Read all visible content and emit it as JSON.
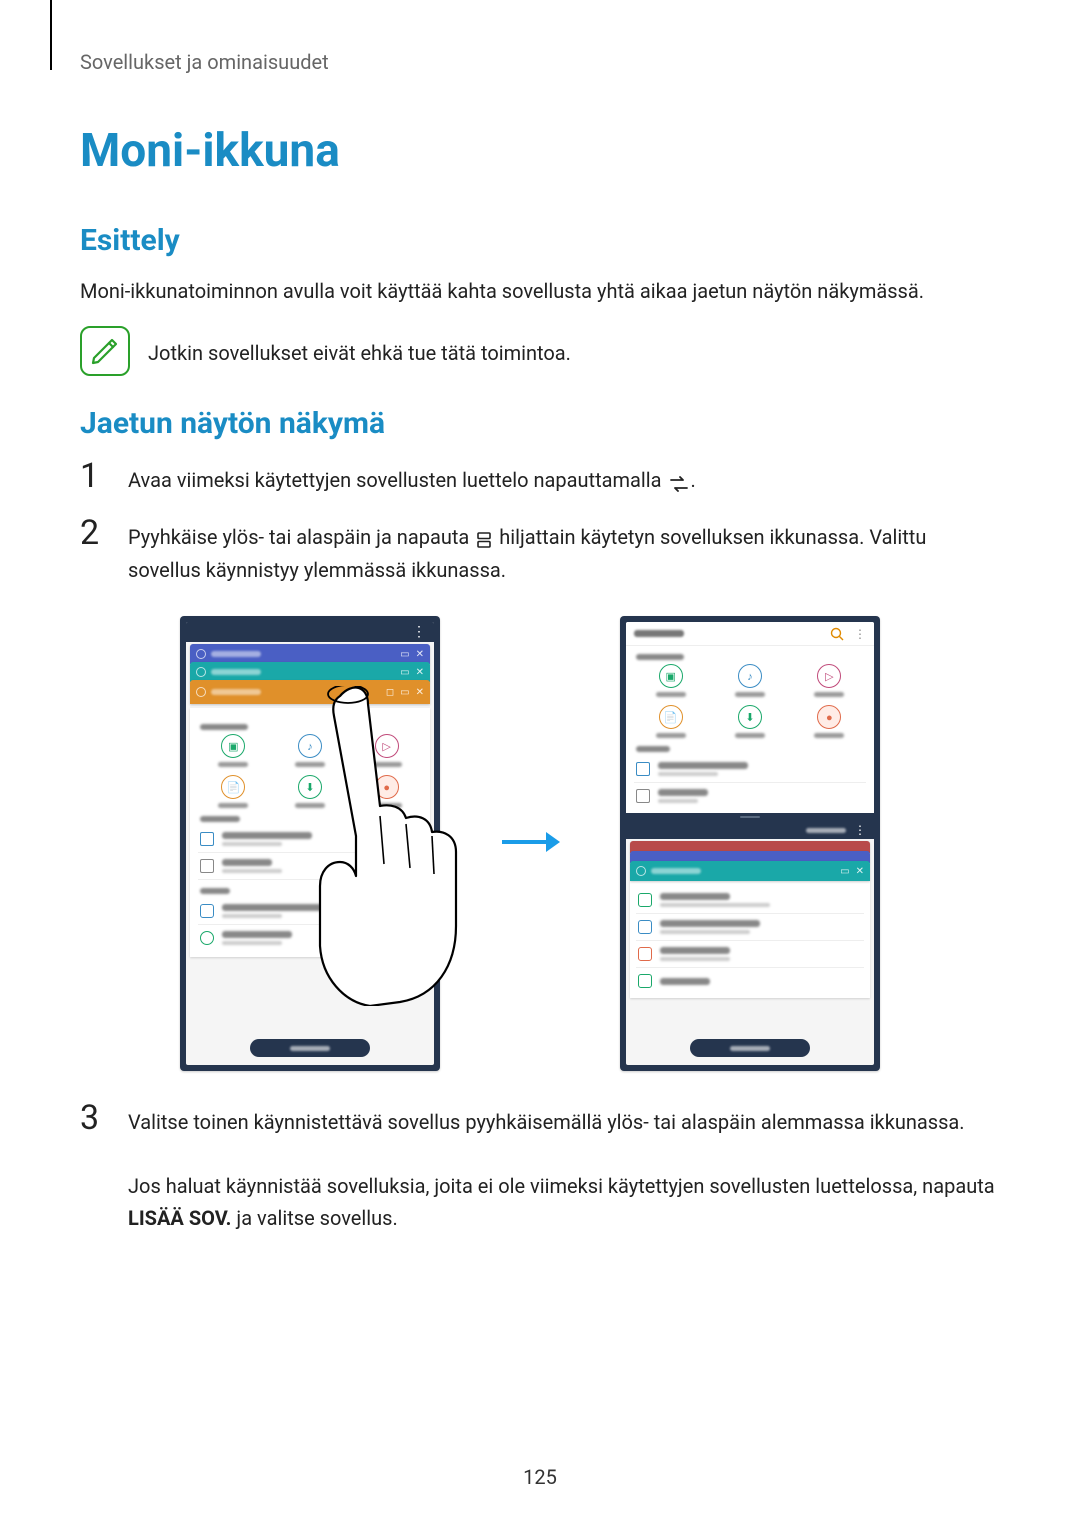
{
  "breadcrumb": "Sovellukset ja ominaisuudet",
  "title": "Moni-ikkuna",
  "section1": {
    "heading": "Esittely",
    "paragraph": "Moni-ikkunatoiminnon avulla voit käyttää kahta sovellusta yhtä aikaa jaetun näytön näkymässä.",
    "note": "Jotkin sovellukset eivät ehkä tue tätä toimintoa."
  },
  "section2": {
    "heading": "Jaetun näytön näkymä",
    "steps": {
      "s1": {
        "num": "1",
        "pre": "Avaa viimeksi käytettyjen sovellusten luettelo napauttamalla ",
        "post": "."
      },
      "s2": {
        "num": "2",
        "pre": "Pyyhkäise ylös- tai alaspäin ja napauta ",
        "post": " hiljattain käytetyn sovelluksen ikkunassa. Valittu sovellus käynnistyy ylemmässä ikkunassa."
      },
      "s3": {
        "num": "3",
        "line1": "Valitse toinen käynnistettävä sovellus pyyhkäisemällä ylös- tai alaspäin alemmassa ikkunassa.",
        "line2_pre": "Jos haluat käynnistää sovelluksia, joita ei ole viimeksi käytettyjen sovellusten luettelossa, napauta ",
        "line2_bold": "LISÄÄ SOV.",
        "line2_post": " ja valitse sovellus."
      }
    }
  },
  "page_number": "125"
}
